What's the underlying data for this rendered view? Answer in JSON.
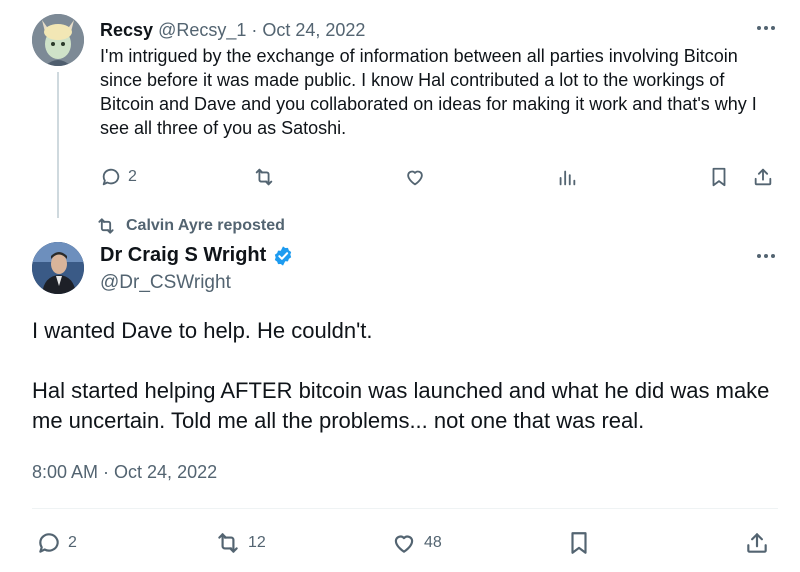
{
  "reply": {
    "author_name": "Recsy",
    "author_handle": "@Recsy_1",
    "separator": " · ",
    "date": "Oct 24, 2022",
    "text": "I'm intrigued by the exchange of information between all parties involving Bitcoin since before it was made public. I know Hal contributed a lot to the workings of Bitcoin and Dave and you collaborated on ideas for making it work and that's why I see all three of you as Satoshi.",
    "reply_count": "2"
  },
  "repost_note": "Calvin Ayre reposted",
  "tweet": {
    "author_name": "Dr Craig S Wright",
    "author_handle": "@Dr_CSWright",
    "verified_color": "#1d9bf0",
    "paragraph_1": "I wanted Dave to help. He couldn't.",
    "paragraph_2": "Hal started helping AFTER bitcoin was launched and what he did was make me uncertain. Told me all the problems... not one that was real.",
    "timestamp": "8:00 AM · Oct 24, 2022",
    "reply_count": "2",
    "repost_count": "12",
    "like_count": "48"
  },
  "icons": {
    "reply": "speech-bubble-icon",
    "repost": "retweet-icon",
    "like": "heart-icon",
    "views": "bar-chart-icon",
    "bookmark": "bookmark-icon",
    "share": "share-upload-icon",
    "more": "three-dots-icon",
    "verified": "verified-badge-icon"
  }
}
